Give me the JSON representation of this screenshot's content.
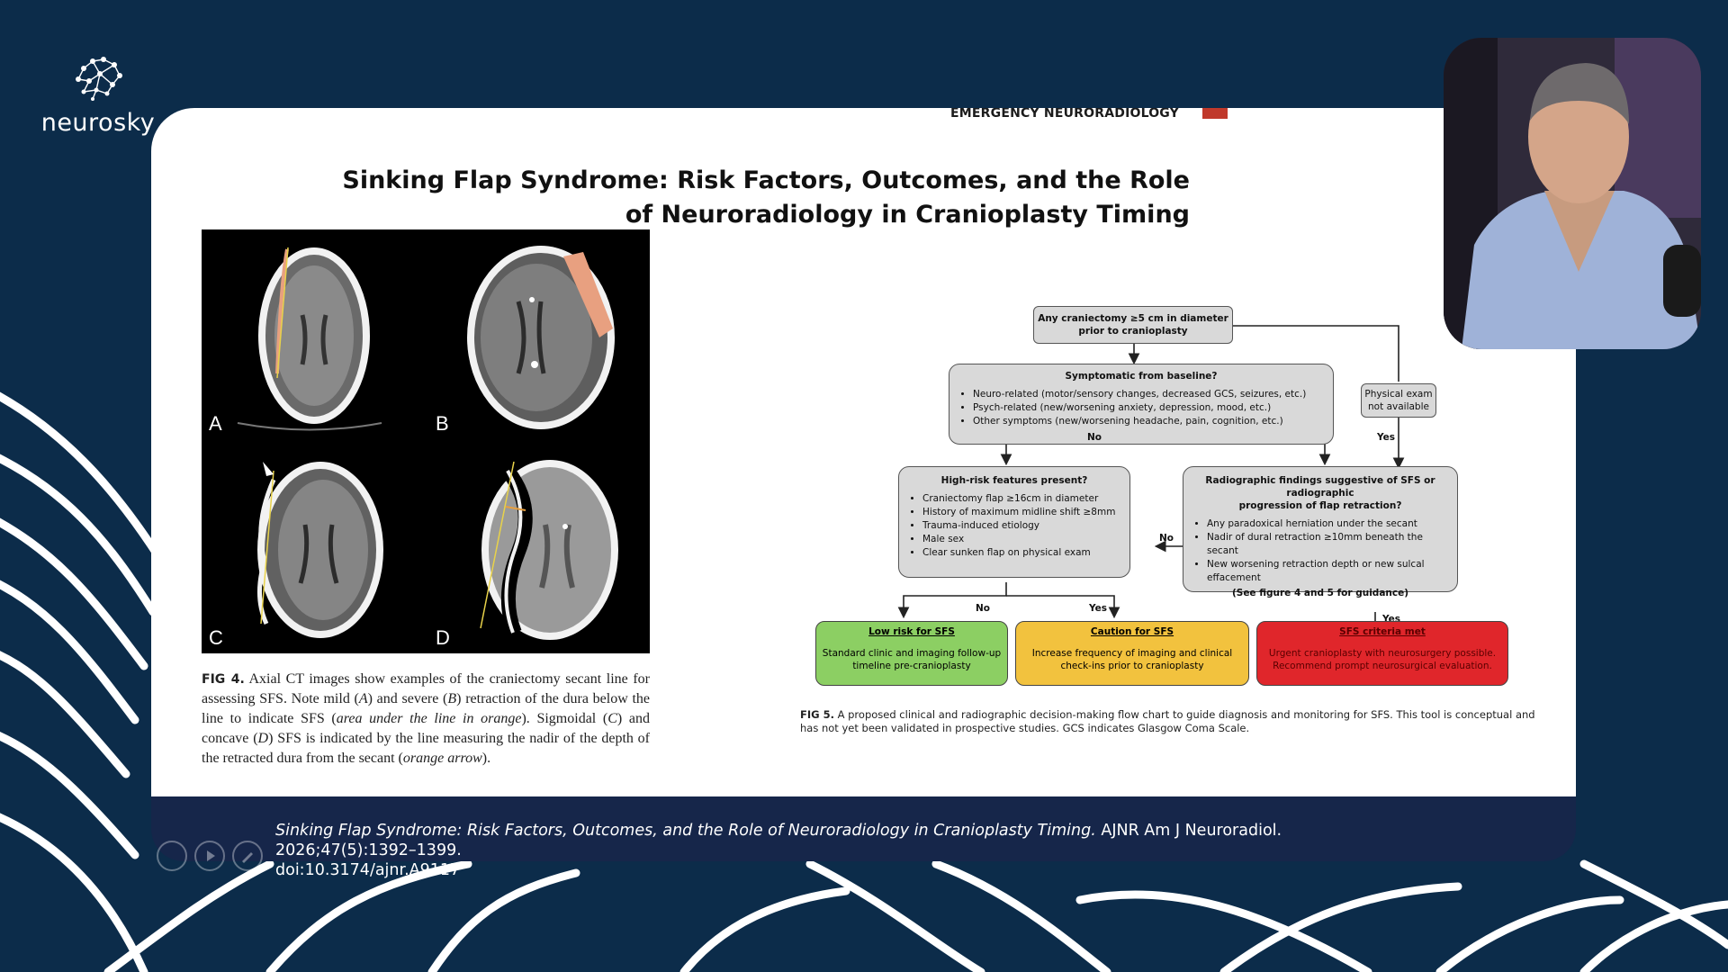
{
  "brand": {
    "name": "neurosky",
    "logo_icon": "brain-network-icon"
  },
  "slide": {
    "section_tag": "EMERGENCY NEURORADIOLOGY",
    "title_line1": "Sinking Flap Syndrome: Risk Factors, Outcomes, and the Role",
    "title_line2": "of Neuroradiology in Cranioplasty Timing",
    "figure4": {
      "panels": [
        "A",
        "B",
        "C",
        "D"
      ],
      "caption_label": "FIG 4.",
      "caption_part1": " Axial CT images show examples of the craniectomy secant line for assessing SFS. Note mild (",
      "caption_a": "A",
      "caption_part2": ") and severe (",
      "caption_b": "B",
      "caption_part3": ") retraction of the dura below the line to indicate SFS (",
      "caption_orange": "area under the line in orange",
      "caption_part4": "). Sigmoidal (",
      "caption_c": "C",
      "caption_part5": ") and concave (",
      "caption_d": "D",
      "caption_part6": ") SFS is indicated by the line measuring the nadir of the depth of the retracted dura from the secant (",
      "caption_arrow": "orange arrow",
      "caption_part7": ")."
    },
    "flowchart": {
      "start": {
        "line1": "Any craniectomy ≥5 cm in diameter",
        "line2": "prior to cranioplasty"
      },
      "symptomatic": {
        "title": "Symptomatic from baseline?",
        "items": [
          "Neuro-related (motor/sensory changes, decreased GCS, seizures, etc.)",
          "Psych-related (new/worsening anxiety, depression, mood, etc.)",
          "Other symptoms (new/worsening headache, pain, cognition, etc.)"
        ]
      },
      "physical_exam": {
        "line1": "Physical exam",
        "line2": "not available"
      },
      "high_risk": {
        "title": "High-risk features present?",
        "items": [
          "Craniectomy flap ≥16cm in diameter",
          "History of maximum midline shift ≥8mm",
          "Trauma-induced etiology",
          "Male sex",
          "Clear sunken flap on physical exam"
        ]
      },
      "radiographic": {
        "title_line1": "Radiographic findings suggestive of SFS or radiographic",
        "title_line2": "progression of flap retraction?",
        "items": [
          "Any paradoxical herniation under the secant",
          "Nadir of dural retraction  ≥10mm beneath the secant",
          "New worsening retraction depth or new sulcal effacement"
        ],
        "note": "(See figure 4 and 5 for guidance)"
      },
      "labels": {
        "no_1": "No",
        "yes_1": "Yes",
        "no_2": "No",
        "no_3": "No",
        "yes_3": "Yes",
        "yes_4": "Yes"
      },
      "outcomes": [
        {
          "title": "Low risk for SFS",
          "text": "Standard clinic and imaging follow-up timeline pre-cranioplasty",
          "color": "#8ccf63"
        },
        {
          "title": "Caution for SFS",
          "text": "Increase frequency of imaging and clinical check-ins prior to cranioplasty",
          "color": "#f2c23e"
        },
        {
          "title": "SFS criteria met",
          "text": "Urgent cranioplasty with neurosurgery possible. Recommend prompt neurosurgical evaluation.",
          "color": "#e0262b"
        }
      ]
    },
    "figure5": {
      "caption_label": "FIG 5.",
      "caption": " A proposed clinical and radiographic decision-making flow chart to guide diagnosis and monitoring for SFS. This tool is conceptual and has not yet been validated in prospective studies. GCS indicates Glasgow Coma Scale."
    }
  },
  "citation": {
    "title": "Sinking Flap Syndrome: Risk Factors, Outcomes, and the Role of Neuroradiology in Cranioplasty Timing.",
    "source": " AJNR Am J Neuroradiol. 2026;47(5):1392–1399.",
    "doi": "doi:10.3174/ajnr.A9117"
  },
  "controls": [
    "previous-icon",
    "play-icon",
    "pen-icon"
  ],
  "colors": {
    "background": "#0c2c4a",
    "citation_bar": "#16264a",
    "accent_red": "#c0392b",
    "flap_orange": "#e8a080"
  }
}
